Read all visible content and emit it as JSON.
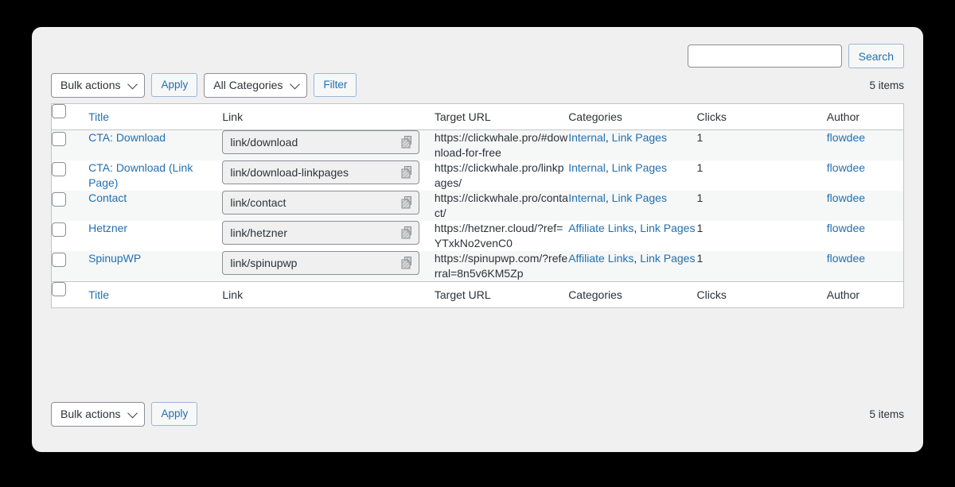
{
  "toolbar": {
    "bulk_actions_label": "Bulk actions",
    "apply_label": "Apply",
    "categories_filter_label": "All Categories",
    "filter_label": "Filter"
  },
  "search": {
    "value": "",
    "placeholder": "",
    "button_label": "Search"
  },
  "counts": {
    "top_items": "5 items",
    "bottom_items": "5 items"
  },
  "table": {
    "columns": [
      {
        "key": "title",
        "label": "Title",
        "is_link": true
      },
      {
        "key": "link",
        "label": "Link",
        "is_link": false
      },
      {
        "key": "url",
        "label": "Target URL",
        "is_link": false
      },
      {
        "key": "cats",
        "label": "Categories",
        "is_link": false
      },
      {
        "key": "clicks",
        "label": "Clicks",
        "is_link": false
      },
      {
        "key": "author",
        "label": "Author",
        "is_link": false
      }
    ],
    "rows": [
      {
        "title": "CTA: Download",
        "link": "link/download",
        "url": "https://clickwhale.pro/#download-for-free",
        "categories": [
          "Internal",
          "Link Pages"
        ],
        "clicks": "1",
        "author": "flowdee"
      },
      {
        "title": "CTA: Download (Link Page)",
        "link": "link/download-linkpages",
        "url": "https://clickwhale.pro/linkpages/",
        "categories": [
          "Internal",
          "Link Pages"
        ],
        "clicks": "1",
        "author": "flowdee"
      },
      {
        "title": "Contact",
        "link": "link/contact",
        "url": "https://clickwhale.pro/contact/",
        "categories": [
          "Internal",
          "Link Pages"
        ],
        "clicks": "1",
        "author": "flowdee"
      },
      {
        "title": "Hetzner",
        "link": "link/hetzner",
        "url": "https://hetzner.cloud/?ref=YTxkNo2venC0",
        "categories": [
          "Affiliate Links",
          "Link Pages"
        ],
        "clicks": "1",
        "author": "flowdee"
      },
      {
        "title": "SpinupWP",
        "link": "link/spinupwp",
        "url": "https://spinupwp.com/?referral=8n5v6KM5Zp",
        "categories": [
          "Affiliate Links",
          "Link Pages"
        ],
        "clicks": "1",
        "author": "flowdee"
      }
    ]
  },
  "icons": {
    "copy": "copy-icon",
    "chevron": "chevron-down-icon"
  },
  "colors": {
    "link": "#2271b1",
    "panel_bg": "#f0f0f1",
    "row_alt_bg": "#f6f7f7",
    "border": "#c3c4c7",
    "text": "#2c3338"
  }
}
